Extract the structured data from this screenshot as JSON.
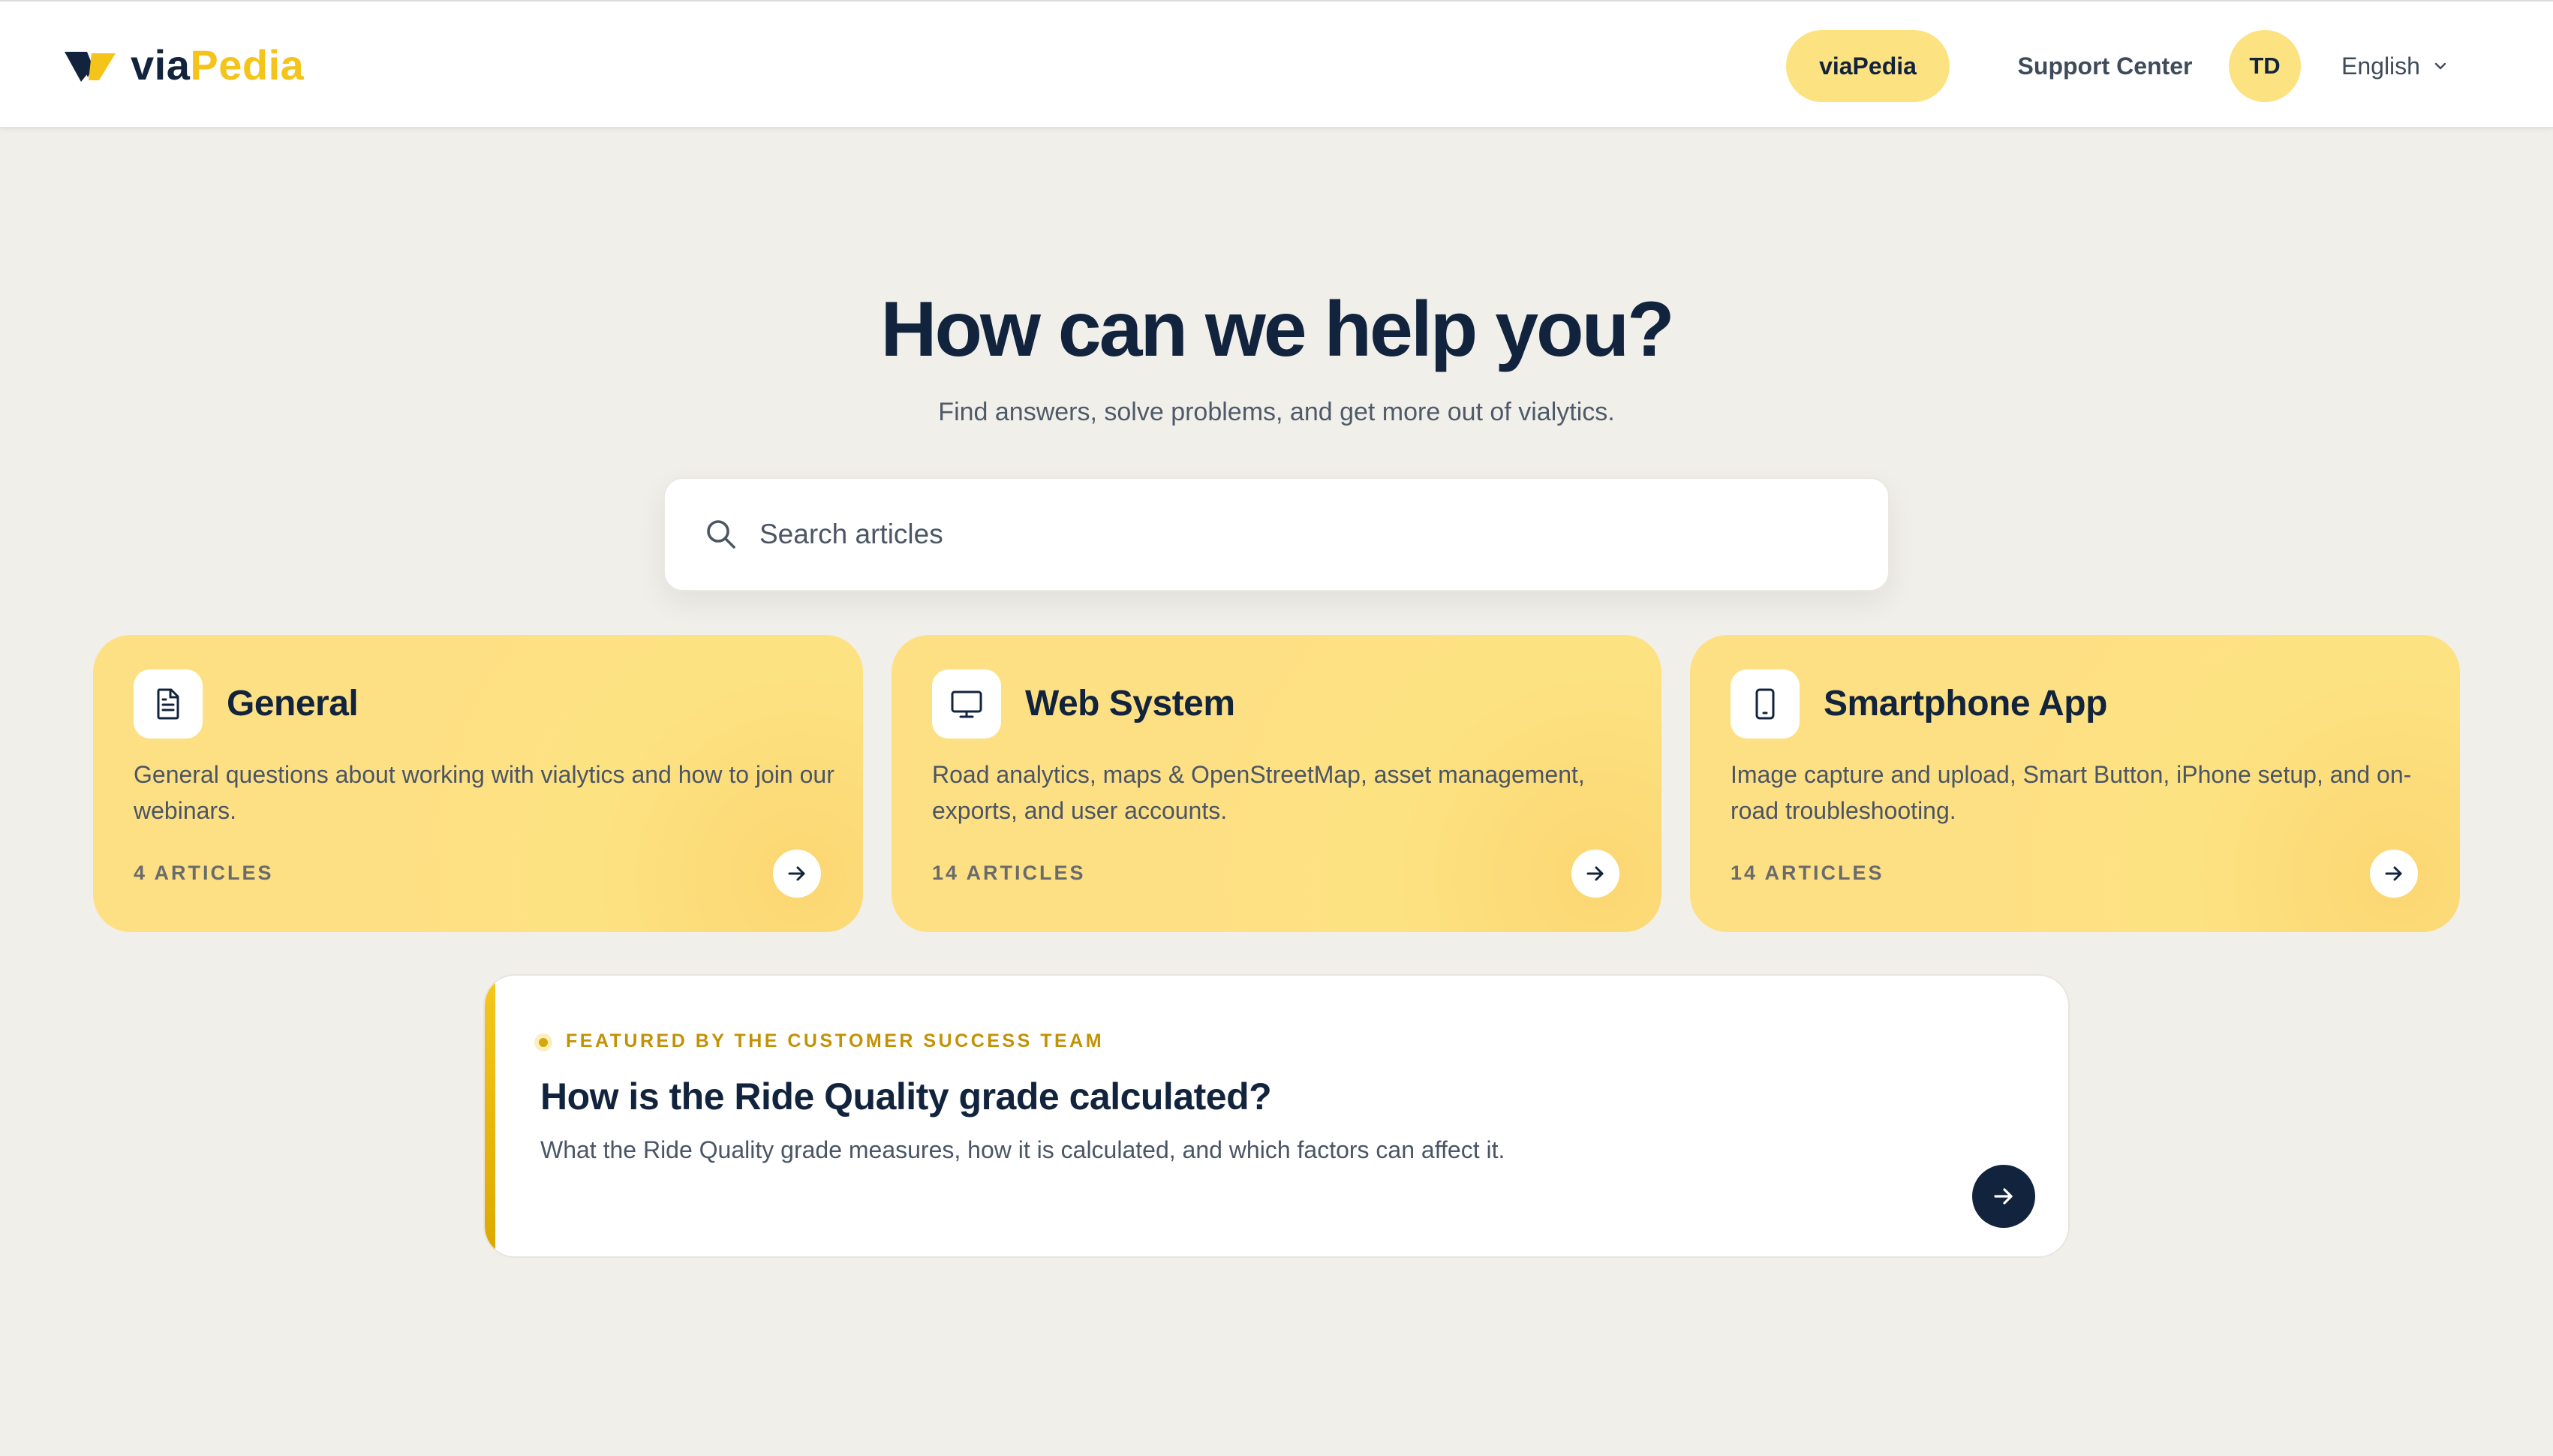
{
  "header": {
    "logo_via": "via",
    "logo_pedia": "Pedia",
    "nav_active": "viaPedia",
    "nav_support": "Support Center",
    "avatar_initials": "TD",
    "language": "English"
  },
  "hero": {
    "title": "How can we help you?",
    "subtitle": "Find answers, solve problems, and get more out of vialytics."
  },
  "search": {
    "placeholder": "Search articles",
    "value": ""
  },
  "categories": [
    {
      "icon": "document-icon",
      "title": "General",
      "description": "General questions about working with vialytics and how to join our webinars.",
      "count": "4 ARTICLES"
    },
    {
      "icon": "monitor-icon",
      "title": "Web System",
      "description": "Road analytics, maps & OpenStreetMap, asset management, exports, and user accounts.",
      "count": "14 ARTICLES"
    },
    {
      "icon": "smartphone-icon",
      "title": "Smartphone App",
      "description": "Image capture and upload, Smart Button, iPhone setup, and on-road troubleshooting.",
      "count": "14 ARTICLES"
    }
  ],
  "featured": {
    "label": "FEATURED BY THE CUSTOMER SUCCESS TEAM",
    "title": "How is the Ride Quality grade calculated?",
    "description": "What the Ride Quality grade measures, how it is calculated, and which factors can affect it."
  },
  "colors": {
    "navy": "#12243d",
    "accent_yellow": "#f4c41a",
    "card_yellow": "#fee084",
    "page_bg": "#f1efea"
  }
}
